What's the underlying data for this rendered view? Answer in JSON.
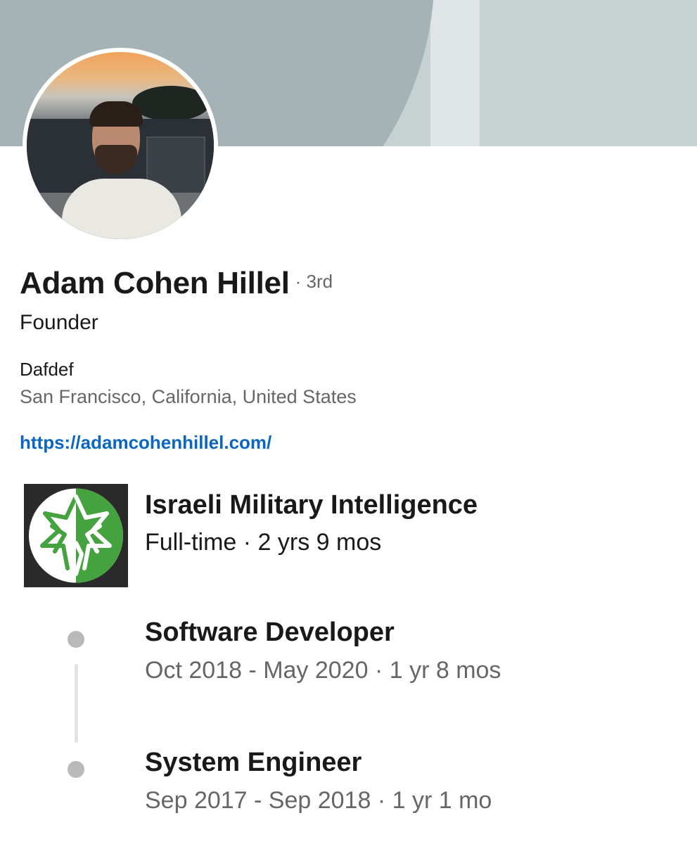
{
  "profile": {
    "name": "Adam Cohen Hillel",
    "connection_degree": "· 3rd",
    "headline": "Founder",
    "company": "Dafdef",
    "location": "San Francisco, California, United States",
    "website": "https://adamcohenhillel.com/"
  },
  "experience": {
    "company": "Israeli Military Intelligence",
    "meta": "Full-time · 2 yrs 9 mos",
    "roles": [
      {
        "title": "Software Developer",
        "dates": "Oct 2018 - May 2020 · 1 yr 8 mos"
      },
      {
        "title": "System Engineer",
        "dates": "Sep 2017 - Sep 2018 · 1 yr 1 mo"
      }
    ]
  },
  "colors": {
    "link": "#0a66c2",
    "banner": "#a5b3b6",
    "logo_green": "#45a33f"
  }
}
